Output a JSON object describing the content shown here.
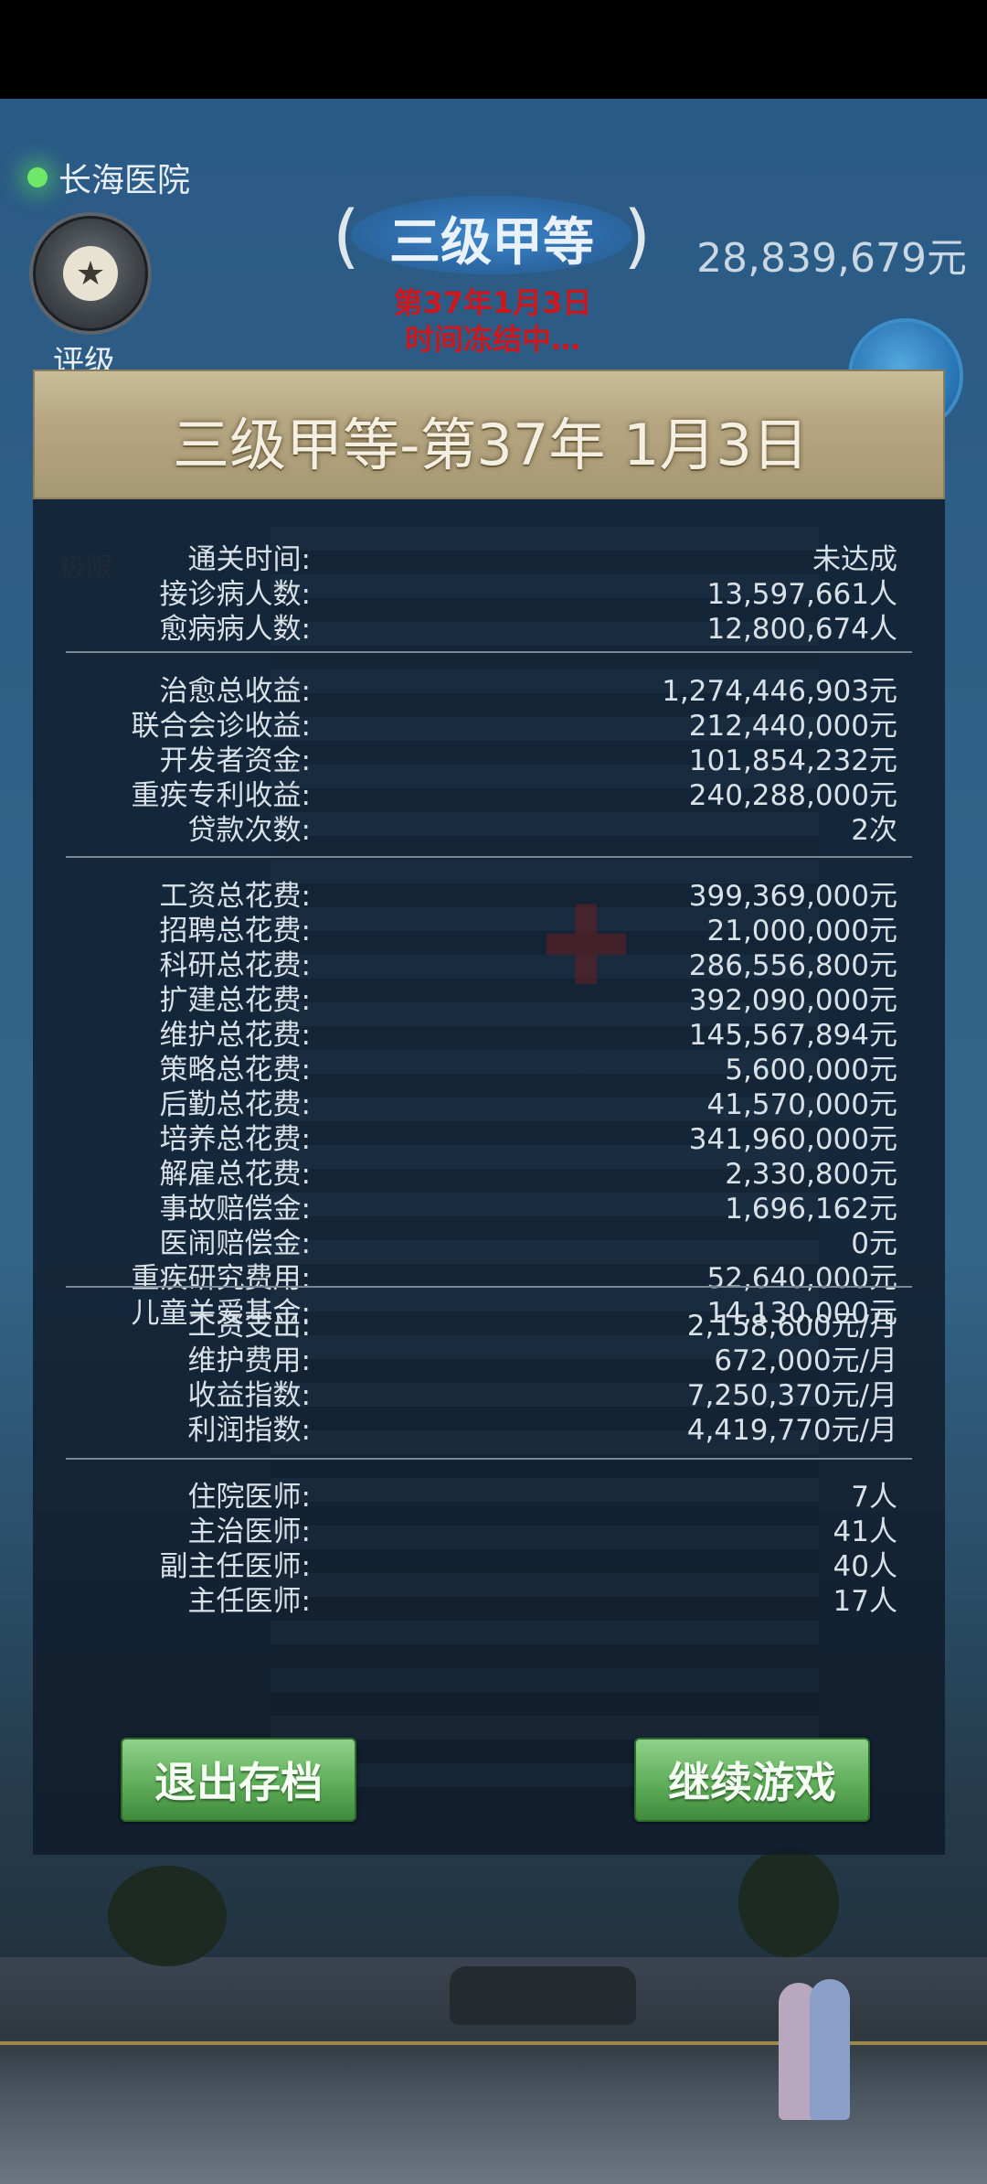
{
  "hud": {
    "hospital_name": "长海医院",
    "rating_label": "评级",
    "rank_title": "三级甲等",
    "date": "第37年1月3日",
    "status": "时间冻结中…",
    "money": "28,839,679元",
    "ghost_label": "极限"
  },
  "panel": {
    "header": "三级甲等-第37年 1月3日",
    "section1": [
      {
        "label": "通关时间:",
        "value": "未达成"
      },
      {
        "label": "接诊病人数:",
        "value": "13,597,661人"
      },
      {
        "label": "愈病病人数:",
        "value": "12,800,674人"
      }
    ],
    "section2": [
      {
        "label": "治愈总收益:",
        "value": "1,274,446,903元"
      },
      {
        "label": "联合会诊收益:",
        "value": "212,440,000元"
      },
      {
        "label": "开发者资金:",
        "value": "101,854,232元"
      },
      {
        "label": "重疾专利收益:",
        "value": "240,288,000元"
      },
      {
        "label": "贷款次数:",
        "value": "2次"
      }
    ],
    "section3": [
      {
        "label": "工资总花费:",
        "value": "399,369,000元"
      },
      {
        "label": "招聘总花费:",
        "value": "21,000,000元"
      },
      {
        "label": "科研总花费:",
        "value": "286,556,800元"
      },
      {
        "label": "扩建总花费:",
        "value": "392,090,000元"
      },
      {
        "label": "维护总花费:",
        "value": "145,567,894元"
      },
      {
        "label": "策略总花费:",
        "value": "5,600,000元"
      },
      {
        "label": "后勤总花费:",
        "value": "41,570,000元"
      },
      {
        "label": "培养总花费:",
        "value": "341,960,000元"
      },
      {
        "label": "解雇总花费:",
        "value": "2,330,800元"
      },
      {
        "label": "事故赔偿金:",
        "value": "1,696,162元"
      },
      {
        "label": "医闹赔偿金:",
        "value": "0元"
      },
      {
        "label": "重疾研究费用:",
        "value": "52,640,000元"
      },
      {
        "label": "儿童关爱基金:",
        "value": "14,130,000元"
      }
    ],
    "section4": [
      {
        "label": "工资支出:",
        "value": "2,158,600元/月"
      },
      {
        "label": "维护费用:",
        "value": "672,000元/月"
      },
      {
        "label": "收益指数:",
        "value": "7,250,370元/月"
      },
      {
        "label": "利润指数:",
        "value": "4,419,770元/月"
      }
    ],
    "section5": [
      {
        "label": "住院医师:",
        "value": "7人"
      },
      {
        "label": "主治医师:",
        "value": "41人"
      },
      {
        "label": "副主任医师:",
        "value": "40人"
      },
      {
        "label": "主任医师:",
        "value": "17人"
      }
    ]
  },
  "buttons": {
    "exit_save": "退出存档",
    "continue_game": "继续游戏"
  },
  "colors": {
    "header_gold": "#b6a682",
    "button_green": "#5fae5a",
    "alert_red": "#c9191f",
    "text_light": "#d9e1e8"
  }
}
